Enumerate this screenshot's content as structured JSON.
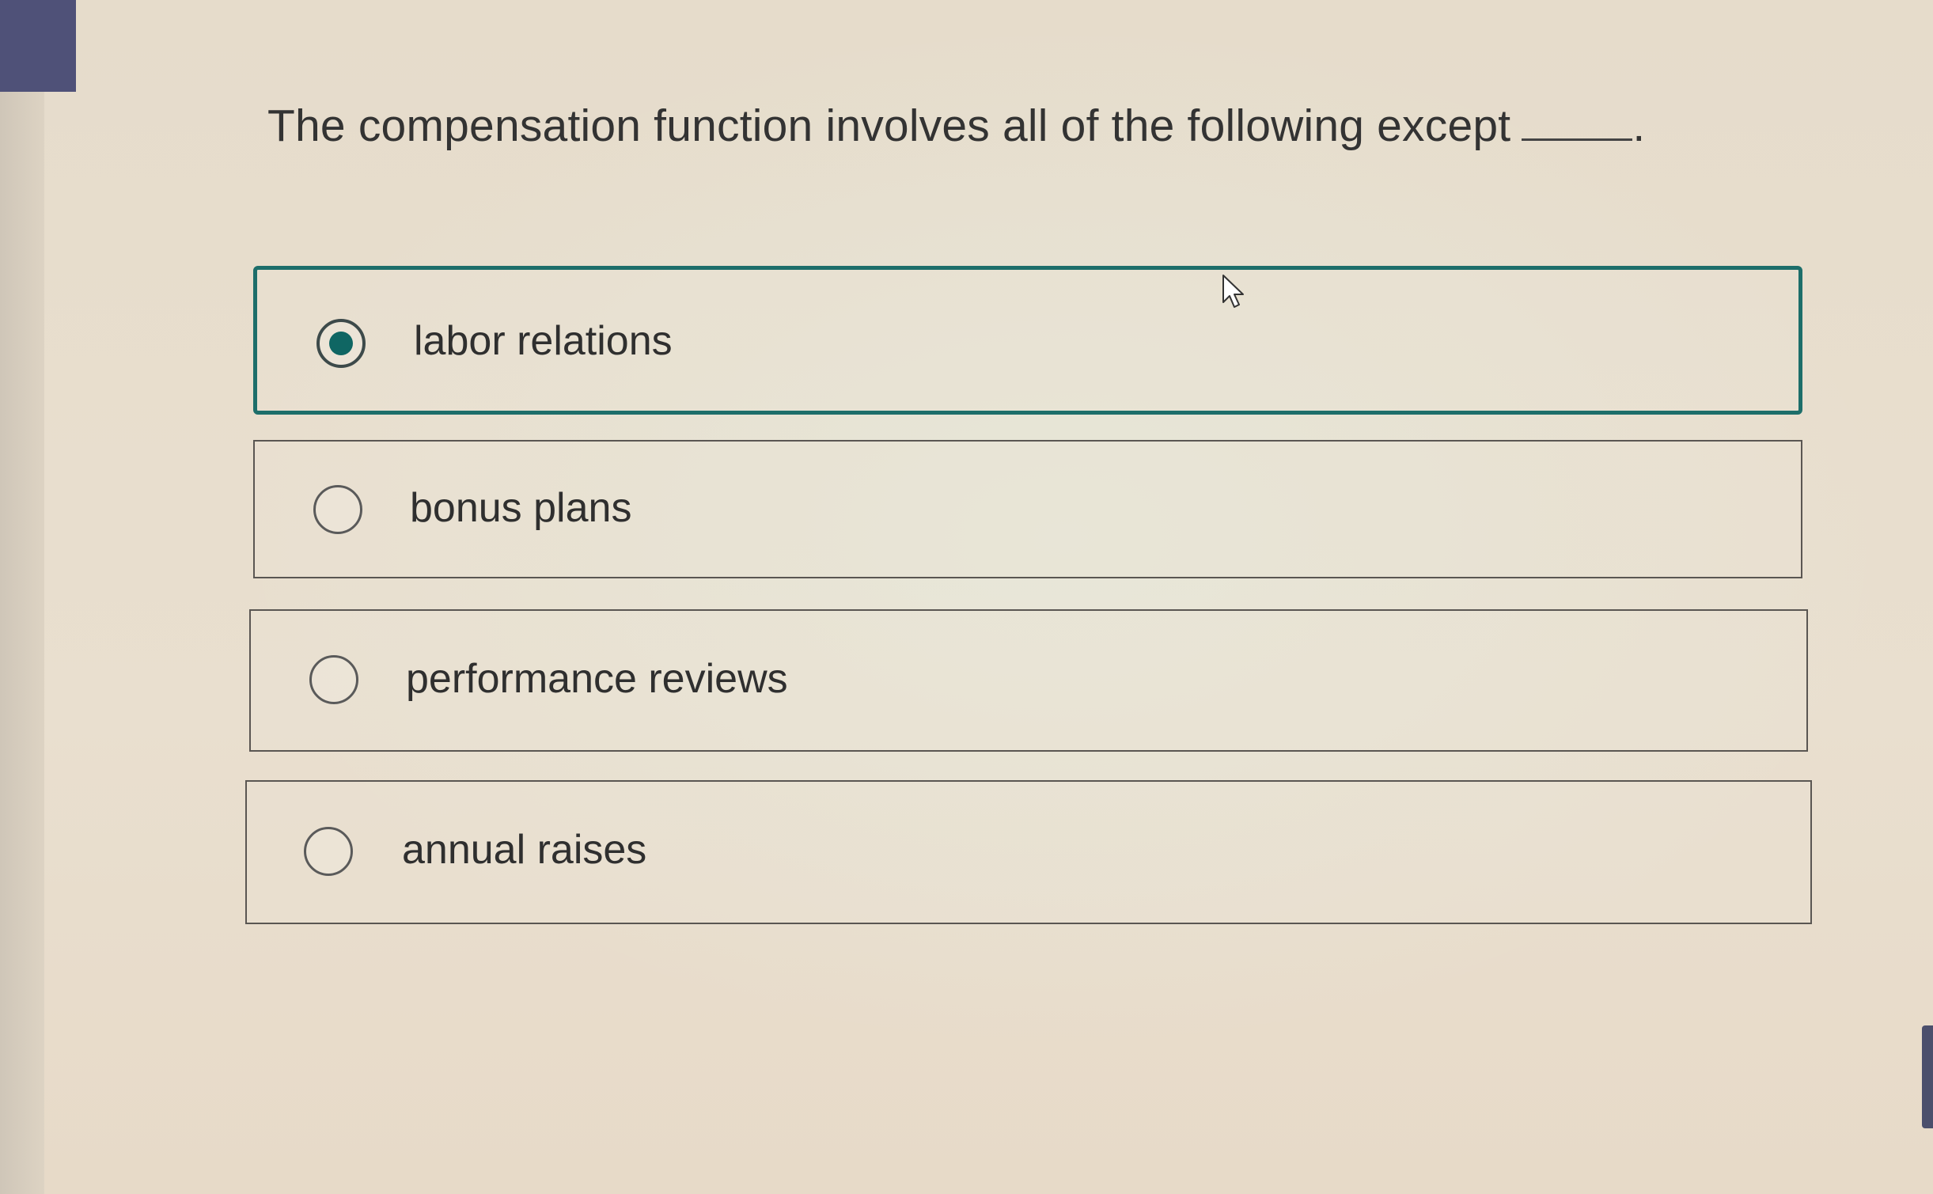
{
  "question": {
    "text": "The compensation function involves all of the following except",
    "blank_suffix": "."
  },
  "options": [
    {
      "label": "labor relations",
      "selected": true
    },
    {
      "label": "bonus plans",
      "selected": false
    },
    {
      "label": "performance reviews",
      "selected": false
    },
    {
      "label": "annual raises",
      "selected": false
    }
  ],
  "colors": {
    "accent": "#1d6e6a",
    "radio_fill": "#0f6663",
    "corner_tab": "#4f5178"
  },
  "icons": {
    "cursor": "mouse-pointer-icon",
    "radio_checked": "radio-checked-icon",
    "radio_unchecked": "radio-unchecked-icon"
  }
}
